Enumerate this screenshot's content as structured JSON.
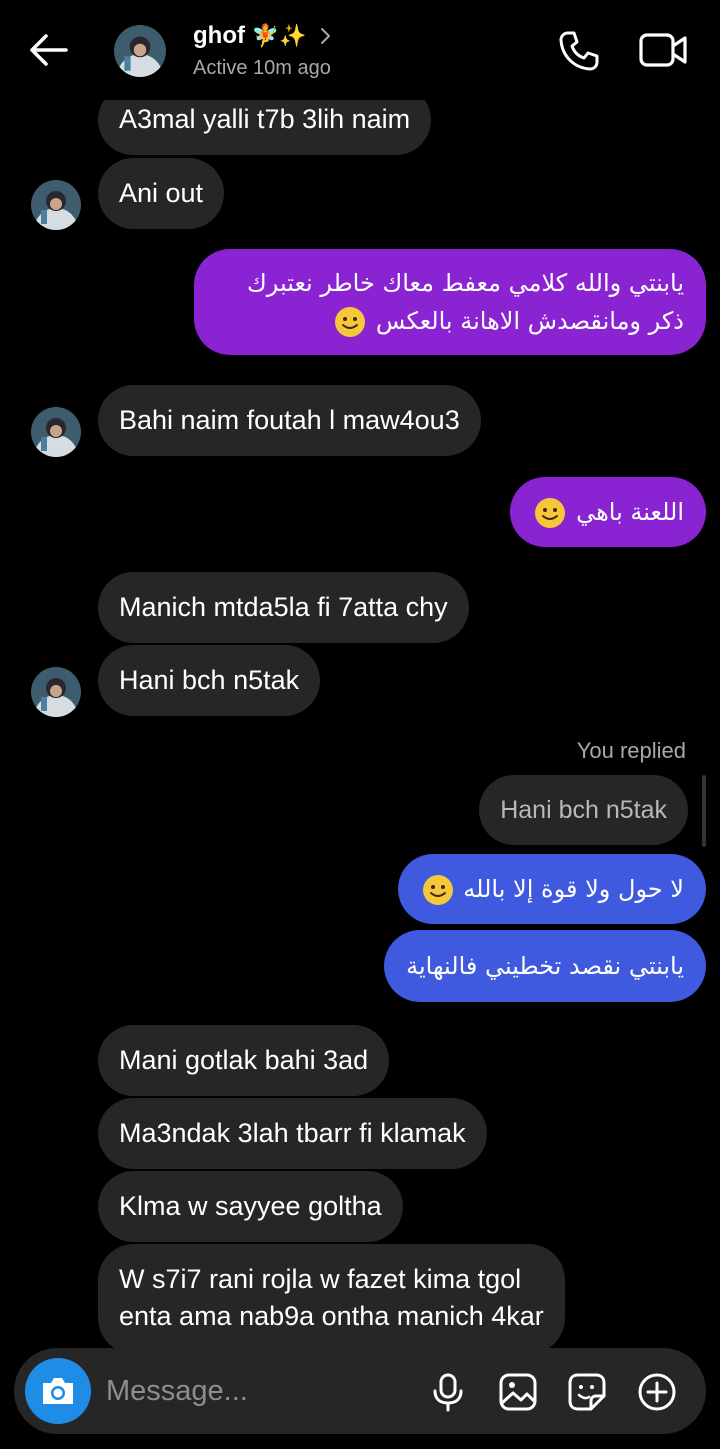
{
  "header": {
    "contact_name": "ghof",
    "name_emoji": "🧚✨",
    "status": "Active 10m ago"
  },
  "messages": {
    "m1": "A3mal yalli t7b 3lih naim",
    "m2": "Ani out",
    "m3_line1": "يابنتي والله كلامي معفط معاك خاطر نعتبرك",
    "m3_line2": "ذكر ومانقصدش الاهانة بالعكس",
    "m4": "Bahi naim foutah l maw4ou3",
    "m5": "اللعنة باهي",
    "m6": "Manich mtda5la fi 7atta chy",
    "m7": "Hani bch n5tak",
    "replied_label": "You replied",
    "reply_quote": "Hani bch n5tak",
    "m8": "لا حول ولا قوة إلا بالله",
    "m9": "يابنتي نقصد تخطيني فالنهاية",
    "m10": "Mani gotlak bahi 3ad",
    "m11": "Ma3ndak 3lah tbarr fi klamak",
    "m12": "Klma w sayyee goltha",
    "m13_line1": "W s7i7 rani rojla w fazet kima tgol",
    "m13_line2": "enta ama nab9a ontha manich 4kar"
  },
  "composer": {
    "placeholder": "Message..."
  },
  "colors": {
    "background": "#000000",
    "incoming_bubble": "#262626",
    "outgoing_purple": "#8a23d2",
    "outgoing_blue": "#3f59df",
    "camera_button": "#1f8de6"
  },
  "icons": [
    "back-arrow-icon",
    "chevron-right-icon",
    "phone-icon",
    "video-camera-icon",
    "camera-icon",
    "microphone-icon",
    "gallery-icon",
    "sticker-icon",
    "plus-circle-icon",
    "smiling-face-icon"
  ]
}
